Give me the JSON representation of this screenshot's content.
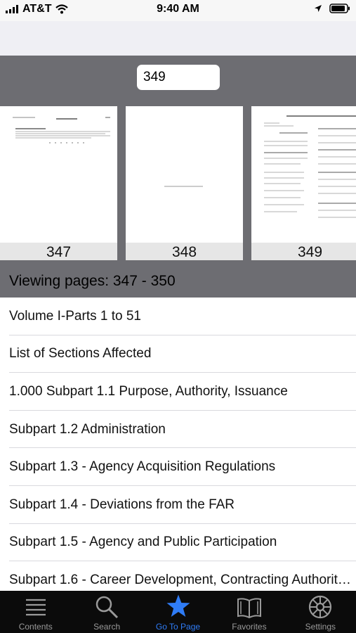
{
  "status": {
    "carrier": "AT&T",
    "time": "9:40 AM"
  },
  "goto": {
    "page_value": "349"
  },
  "thumbnails": [
    {
      "page": "347"
    },
    {
      "page": "348"
    },
    {
      "page": "349"
    }
  ],
  "viewing_text": "Viewing pages: 347 - 350",
  "contents": [
    "Volume I-Parts 1 to 51",
    "List of Sections Affected",
    "1.000 Subpart 1.1 Purpose, Authority, Issuance",
    "Subpart 1.2 Administration",
    "Subpart 1.3 - Agency Acquisition Regulations",
    "Subpart 1.4 - Deviations from the FAR",
    "Subpart 1.5 - Agency and Public Participation",
    "Subpart 1.6 - Career Development, Contracting Authorit…"
  ],
  "tabs": [
    {
      "label": "Contents",
      "icon": "list-icon"
    },
    {
      "label": "Search",
      "icon": "search-icon"
    },
    {
      "label": "Go To Page",
      "icon": "star-icon"
    },
    {
      "label": "Favorites",
      "icon": "book-icon"
    },
    {
      "label": "Settings",
      "icon": "gear-wheel-icon"
    }
  ],
  "colors": {
    "active_tab": "#2f7cf6",
    "strip_bg": "#6d6d72",
    "tabbar_bg": "#0b0b0b"
  }
}
